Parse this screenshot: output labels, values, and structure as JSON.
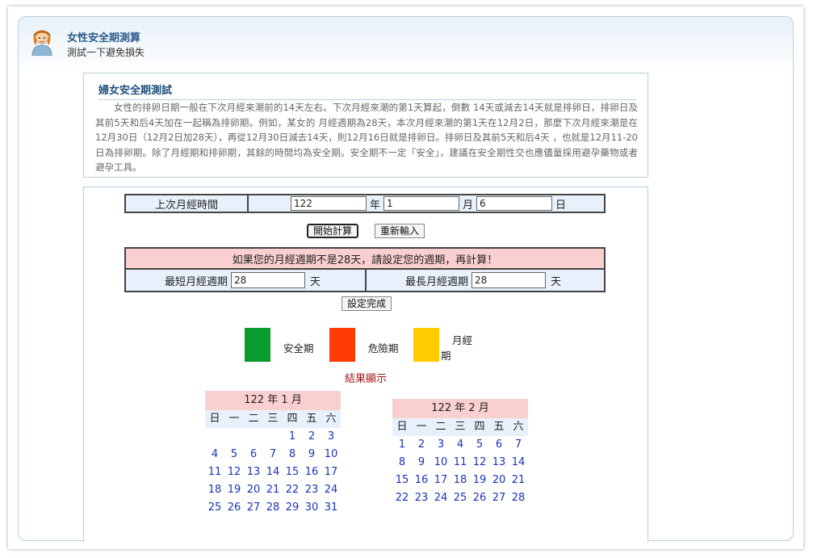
{
  "header": {
    "title": "女性安全期測算",
    "subtitle": "測試一下避免損失"
  },
  "intro": {
    "title": "婦女安全期測試",
    "text": "女性的排卵日期一般在下次月經來潮前的14天左右。下次月經來潮的第1天算起，倒數 14天或減去14天就是排卵日，排卵日及其前5天和后4天加在一起稱為排卵期。例如，某女的 月經週期為28天，本次月經來潮的第1天在12月2日，那麼下次月經來潮是在12月30日（12月2日加28天），再從12月30日減去14天，則12月16日就是排卵日。排卵日及其前5天和后4天 ，也就是12月11-20日為排卵期。除了月經期和排卵期，其餘的時間均為安全期。安全期不一定「安全」，建議在安全期性交也應儘量採用避孕藥物或者避孕工具。"
  },
  "form": {
    "last_period_label": "上次月經時間",
    "year_value": "122",
    "year_unit": "年",
    "month_value": "1",
    "month_unit": "月",
    "day_value": "6",
    "day_unit": "日",
    "start_button": "開始計算",
    "reset_button": "重新輸入",
    "cycle_notice": "如果您的月經週期不是28天，請設定您的週期，再計算！",
    "min_cycle_label": "最短月經週期",
    "min_cycle_value": "28",
    "max_cycle_label": "最長月經週期",
    "max_cycle_value": "28",
    "cycle_unit": "天",
    "set_button": "設定完成"
  },
  "legend": {
    "safe_label": "安全期",
    "safe_color": "#0a9b2e",
    "danger_label": "危險期",
    "danger_color": "#ff3c05",
    "period_label_1": "月經",
    "period_label_2": "期",
    "period_color": "#ffcc00"
  },
  "result_title": "結果顯示",
  "weekdays": [
    "日",
    "一",
    "二",
    "三",
    "四",
    "五",
    "六"
  ],
  "calendars": [
    {
      "title": "122 年 1 月",
      "days": [
        "",
        "",
        "",
        "",
        "1",
        "2",
        "3",
        "4",
        "5",
        "6",
        "7",
        "8",
        "9",
        "10",
        "11",
        "12",
        "13",
        "14",
        "15",
        "16",
        "17",
        "18",
        "19",
        "20",
        "21",
        "22",
        "23",
        "24",
        "25",
        "26",
        "27",
        "28",
        "29",
        "30",
        "31"
      ]
    },
    {
      "title": "122 年 2 月",
      "days": [
        "1",
        "2",
        "3",
        "4",
        "5",
        "6",
        "7",
        "8",
        "9",
        "10",
        "11",
        "12",
        "13",
        "14",
        "15",
        "16",
        "17",
        "18",
        "19",
        "20",
        "21",
        "22",
        "23",
        "24",
        "25",
        "26",
        "27",
        "28"
      ]
    }
  ]
}
